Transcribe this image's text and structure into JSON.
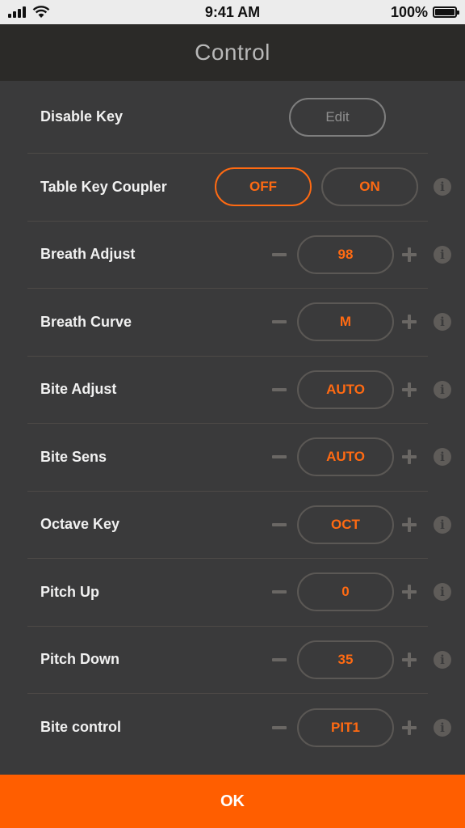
{
  "status_bar": {
    "time": "9:41 AM",
    "battery_text": "100%",
    "battery_level": 1.0,
    "icons": [
      "cellular-signal-icon",
      "wifi-icon",
      "battery-icon"
    ]
  },
  "header": {
    "title": "Control"
  },
  "rows": [
    {
      "label": "Disable Key",
      "button": "Edit"
    },
    {
      "label": "Table Key Coupler",
      "off_label": "OFF",
      "on_label": "ON",
      "selected": "OFF"
    },
    {
      "label": "Breath Adjust",
      "value": "98"
    },
    {
      "label": "Breath Curve",
      "value": "M"
    },
    {
      "label": "Bite Adjust",
      "value": "AUTO"
    },
    {
      "label": "Bite Sens",
      "value": "AUTO"
    },
    {
      "label": "Octave Key",
      "value": "OCT"
    },
    {
      "label": "Pitch Up",
      "value": "0"
    },
    {
      "label": "Pitch Down",
      "value": "35"
    },
    {
      "label": "Bite control",
      "value": "PIT1"
    }
  ],
  "info_icon_glyph": "i",
  "footer": {
    "ok_label": "OK"
  },
  "colors": {
    "accent": "#ff6a12",
    "ok_bar": "#ff5e00",
    "background": "#3a3a3b",
    "title_bar": "#2b2a28"
  }
}
